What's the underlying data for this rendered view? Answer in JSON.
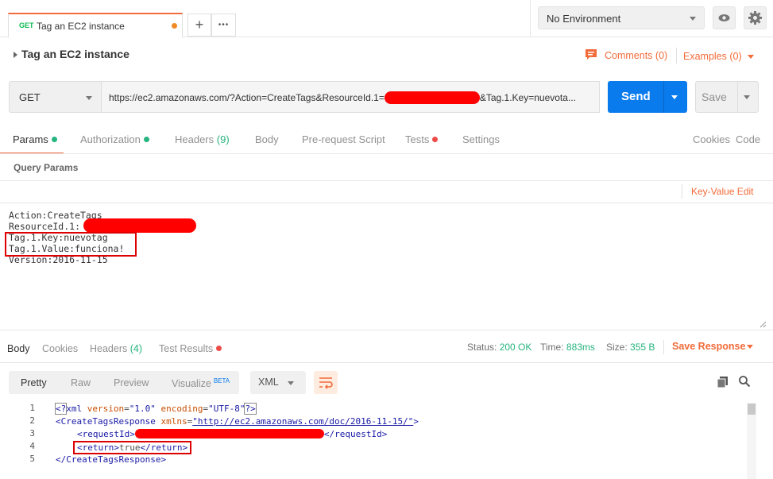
{
  "tab": {
    "method": "GET",
    "title": "Tag an EC2 instance",
    "new_tab_label": "+",
    "more_label": "•••"
  },
  "environment": {
    "selected": "No Environment"
  },
  "request": {
    "name": "Tag an EC2 instance",
    "comments_label": "Comments (0)",
    "examples_label": "Examples (0)",
    "method": "GET",
    "url_prefix": "https://ec2.amazonaws.com/?Action=CreateTags&ResourceId.1=",
    "url_suffix": "&Tag.1.Key=nuevota...",
    "send_label": "Send",
    "save_label": "Save"
  },
  "request_tabs": [
    {
      "label": "Params"
    },
    {
      "label": "Authorization"
    },
    {
      "label": "Headers",
      "count": "(9)"
    },
    {
      "label": "Body"
    },
    {
      "label": "Pre-request Script"
    },
    {
      "label": "Tests"
    },
    {
      "label": "Settings"
    }
  ],
  "cookies_label": "Cookies",
  "code_label": "Code",
  "query_params_title": "Query Params",
  "key_value_edit_label": "Key-Value Edit",
  "bulk_lines": [
    "Action:CreateTags",
    "ResourceId.1:",
    "Tag.1.Key:nuevotag",
    "Tag.1.Value:funciona!",
    "Version:2016-11-15"
  ],
  "response_tabs": [
    {
      "label": "Body"
    },
    {
      "label": "Cookies"
    },
    {
      "label": "Headers",
      "count": "(4)"
    },
    {
      "label": "Test Results"
    }
  ],
  "status": {
    "status_label": "Status:",
    "status_value": "200 OK",
    "time_label": "Time:",
    "time_value": "883ms",
    "size_label": "Size:",
    "size_value": "355 B",
    "save_response_label": "Save Response"
  },
  "view_modes": [
    "Pretty",
    "Raw",
    "Preview",
    "Visualize"
  ],
  "beta_label": "BETA",
  "format_selected": "XML",
  "code_lines": [
    {
      "n": "1"
    },
    {
      "n": "2"
    },
    {
      "n": "3"
    },
    {
      "n": "4"
    },
    {
      "n": "5"
    }
  ],
  "xml": {
    "decl_open": "<?",
    "decl_name": "xml",
    "version_attr": "version",
    "version_val": "\"1.0\"",
    "encoding_attr": "encoding",
    "encoding_val": "\"UTF-8\"",
    "decl_close": "?>",
    "root_open": "<CreateTagsResponse",
    "xmlns_attr": "xmlns",
    "eq": "=",
    "xmlns_val": "\"http://ec2.amazonaws.com/doc/2016-11-15/\"",
    "root_gt": ">",
    "reqid_open": "<requestId>",
    "reqid_close": "</requestId>",
    "return_open": "<return>",
    "return_value": "true",
    "return_close": "</return>",
    "root_close": "</CreateTagsResponse>"
  },
  "colors": {
    "accent": "#f26b3a",
    "send": "#097bed",
    "success": "#26b47f",
    "error": "#ed4b48"
  }
}
